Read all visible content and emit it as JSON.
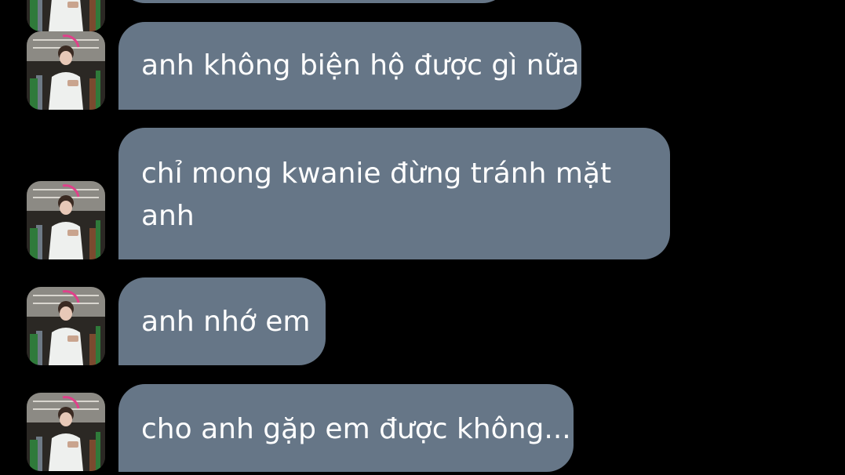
{
  "conversation": {
    "messages": [
      {
        "text": ""
      },
      {
        "text": "anh không biện hộ được gì nữa"
      },
      {
        "text": "chỉ mong kwanie đừng tránh mặt anh"
      },
      {
        "text": "anh nhớ em"
      },
      {
        "text": "cho anh gặp em được không..."
      }
    ]
  },
  "colors": {
    "background": "#000000",
    "bubble": "#667687",
    "text": "#ffffff"
  },
  "icons": {
    "avatar": "profile-photo"
  }
}
